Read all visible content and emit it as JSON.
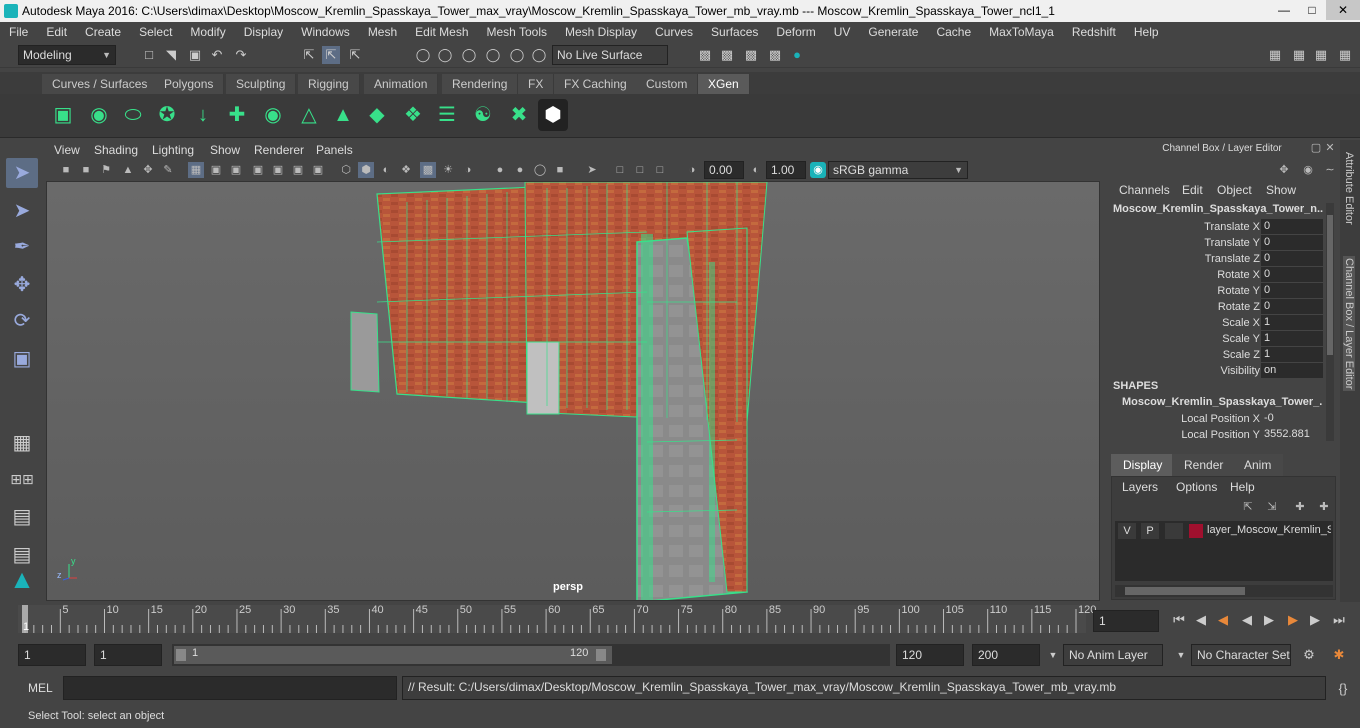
{
  "app": {
    "title": "Autodesk Maya 2016: C:\\Users\\dimax\\Desktop\\Moscow_Kremlin_Spasskaya_Tower_max_vray\\Moscow_Kremlin_Spasskaya_Tower_mb_vray.mb  ---  Moscow_Kremlin_Spasskaya_Tower_ncl1_1",
    "colors": {
      "accent": "#38e08a",
      "background": "#444444",
      "brand": "#1ab3b9"
    }
  },
  "menubar": [
    "File",
    "Edit",
    "Create",
    "Select",
    "Modify",
    "Display",
    "Windows",
    "Mesh",
    "Edit Mesh",
    "Mesh Tools",
    "Mesh Display",
    "Curves",
    "Surfaces",
    "Deform",
    "UV",
    "Generate",
    "Cache",
    "MaxToMaya",
    "Redshift",
    "Help"
  ],
  "statusline": {
    "menuset": "Modeling",
    "live_surface": "No Live Surface"
  },
  "shelf_tabs": [
    "Curves / Surfaces",
    "Polygons",
    "Sculpting",
    "Rigging",
    "Animation",
    "Rendering",
    "FX",
    "FX Caching",
    "Custom",
    "XGen"
  ],
  "shelf_active": "XGen",
  "viewport": {
    "menus": [
      "View",
      "Shading",
      "Lighting",
      "Show",
      "Renderer",
      "Panels"
    ],
    "exposure": "0.00",
    "gamma": "1.00",
    "color_space": "sRGB gamma",
    "camera": "persp",
    "axis_y": "y",
    "axis_z": "z"
  },
  "channelbox": {
    "title": "Channel Box / Layer Editor",
    "menus": [
      "Channels",
      "Edit",
      "Object",
      "Show"
    ],
    "object": "Moscow_Kremlin_Spasskaya_Tower_n...",
    "attributes": [
      {
        "label": "Translate X",
        "value": "0"
      },
      {
        "label": "Translate Y",
        "value": "0"
      },
      {
        "label": "Translate Z",
        "value": "0"
      },
      {
        "label": "Rotate X",
        "value": "0"
      },
      {
        "label": "Rotate Y",
        "value": "0"
      },
      {
        "label": "Rotate Z",
        "value": "0"
      },
      {
        "label": "Scale X",
        "value": "1"
      },
      {
        "label": "Scale Y",
        "value": "1"
      },
      {
        "label": "Scale Z",
        "value": "1"
      },
      {
        "label": "Visibility",
        "value": "on"
      }
    ],
    "shapes_header": "SHAPES",
    "shape_name": "Moscow_Kremlin_Spasskaya_Tower_...",
    "shape_attributes": [
      {
        "label": "Local Position X",
        "value": "-0"
      },
      {
        "label": "Local Position Y",
        "value": "3552.881"
      }
    ]
  },
  "side_tabs": [
    "Attribute Editor",
    "Channel Box / Layer Editor"
  ],
  "layer_editor": {
    "tabs": [
      "Display",
      "Render",
      "Anim"
    ],
    "menus": [
      "Layers",
      "Options",
      "Help"
    ],
    "layer": {
      "v": "V",
      "p": "P",
      "name": "layer_Moscow_Kremlin_S",
      "color": "#a0102e"
    }
  },
  "timeline": {
    "ticks": [
      "5",
      "10",
      "15",
      "20",
      "25",
      "30",
      "35",
      "40",
      "45",
      "50",
      "55",
      "60",
      "65",
      "70",
      "75",
      "80",
      "85",
      "90",
      "95",
      "100",
      "105",
      "110",
      "115",
      "120"
    ],
    "current_frame_marker": "1",
    "current_frame": "1"
  },
  "range": {
    "start": "1",
    "playback_start": "1",
    "slider_start": "1",
    "slider_end": "120",
    "playback_end": "120",
    "end": "200",
    "anim_layer": "No Anim Layer",
    "character_set": "No Character Set"
  },
  "command": {
    "label": "MEL",
    "result": "// Result: C:/Users/dimax/Desktop/Moscow_Kremlin_Spasskaya_Tower_max_vray/Moscow_Kremlin_Spasskaya_Tower_mb_vray.mb"
  },
  "helpline": "Select Tool: select an object"
}
